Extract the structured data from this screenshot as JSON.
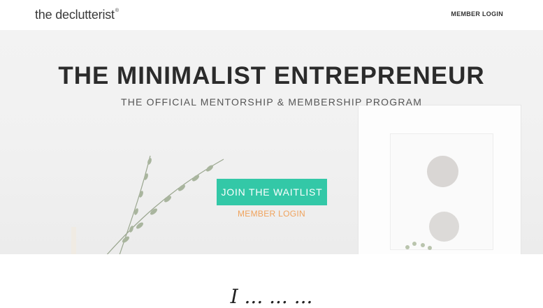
{
  "header": {
    "logo_text": "the declutterist",
    "logo_mark": "®",
    "member_login": "MEMBER LOGIN"
  },
  "hero": {
    "title": "THE MINIMALIST ENTREPRENEUR",
    "subtitle": "THE OFFICIAL MENTORSHIP & MEMBERSHIP PROGRAM",
    "cta_label": "JOIN THE WAITLIST",
    "login_link": "MEMBER LOGIN"
  },
  "lower": {
    "script_heading": "I ... ... ..."
  },
  "colors": {
    "accent": "#33c8a7",
    "login_orange": "#f0a35d"
  }
}
